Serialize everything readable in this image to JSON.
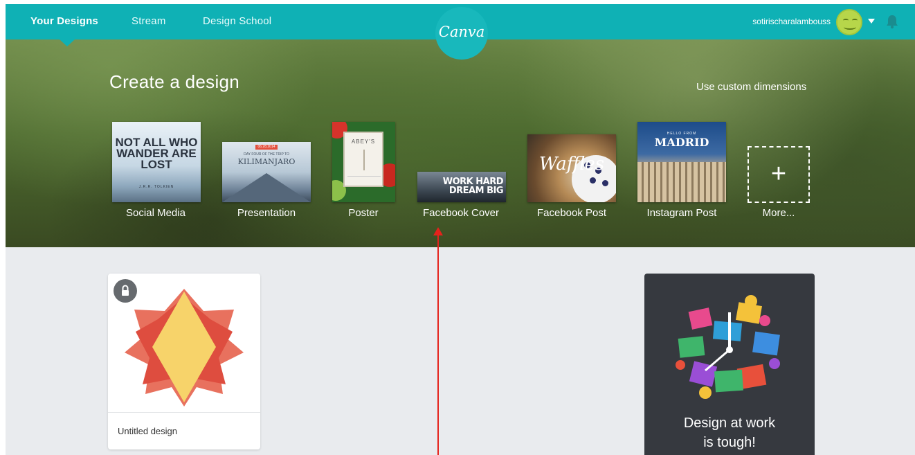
{
  "nav": {
    "items": [
      "Your Designs",
      "Stream",
      "Design School"
    ],
    "logo_text": "Canva",
    "username": "sotirischaralambouss"
  },
  "hero": {
    "title": "Create a design",
    "custom_dimensions": "Use custom dimensions",
    "templates": [
      {
        "label": "Social Media",
        "thumb_text": "NOT ALL WHO WANDER ARE LOST",
        "thumb_sub": "J.R.R. TOLKIEN"
      },
      {
        "label": "Presentation",
        "thumb_tag": "06.28.2014",
        "thumb_small": "DAY FOUR OF THE TRIP TO",
        "thumb_text": "KILIMANJARO"
      },
      {
        "label": "Poster",
        "thumb_text": "ABEY'S"
      },
      {
        "label": "Facebook Cover",
        "thumb_line1": "WORK HARD",
        "thumb_line2": "DREAM BIG"
      },
      {
        "label": "Facebook Post",
        "thumb_text": "Waffles"
      },
      {
        "label": "Instagram Post",
        "thumb_small": "HELLO FROM",
        "thumb_text": "MADRID"
      },
      {
        "label": "More...",
        "thumb_text": "+"
      }
    ]
  },
  "designs": [
    {
      "title": "Untitled design",
      "locked": true
    }
  ],
  "promo": {
    "line1": "Design at work",
    "line2": "is tough!"
  },
  "colors": {
    "nav_bg": "#0fb1b5",
    "body_bg": "#e9ebee",
    "promo_bg": "#36393f",
    "annotation": "#e5221c"
  }
}
